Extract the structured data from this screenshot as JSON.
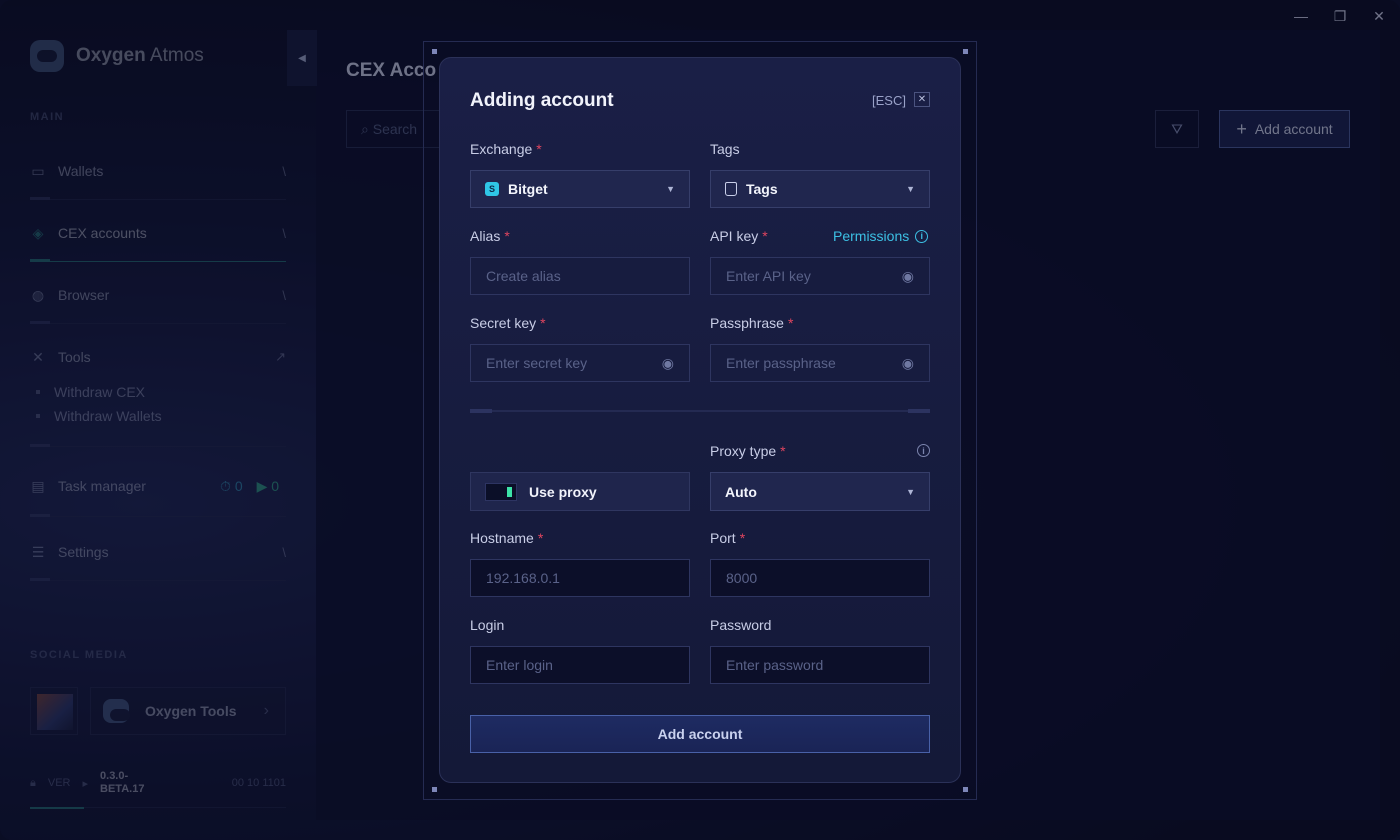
{
  "app": {
    "brand_bold": "Oxygen",
    "brand_light": " Atmos"
  },
  "window_controls": {
    "minimize": "—",
    "restore": "❐",
    "close": "✕"
  },
  "sidebar": {
    "section_main": "MAIN",
    "items": [
      {
        "label": "Wallets",
        "icon": "wallet-icon",
        "arrow": "\\"
      },
      {
        "label": "CEX accounts",
        "icon": "layers-icon",
        "arrow": "\\"
      },
      {
        "label": "Browser",
        "icon": "globe-icon",
        "arrow": "\\"
      },
      {
        "label": "Tools",
        "icon": "tools-icon",
        "arrow": "↗"
      },
      {
        "label": "Task manager",
        "icon": "task-icon"
      },
      {
        "label": "Settings",
        "icon": "sliders-icon",
        "arrow": "\\"
      }
    ],
    "tools_sub": [
      "Withdraw CEX",
      "Withdraw Wallets"
    ],
    "task_counters": {
      "scheduled": "0",
      "running": "0"
    },
    "section_social": "SOCIAL MEDIA",
    "social_name": "Oxygen Tools",
    "version_label": "VER",
    "version_value": "0.3.0-\nBETA.17",
    "version_extra": "00 10 1101"
  },
  "main": {
    "title": "CEX Acco",
    "search_placeholder": "Search",
    "add_account": "Add account"
  },
  "modal": {
    "title": "Adding account",
    "esc": "[ESC]",
    "exchange_label": "Exchange",
    "exchange_value": "Bitget",
    "tags_label": "Tags",
    "tags_value": "Tags",
    "alias_label": "Alias",
    "alias_placeholder": "Create alias",
    "api_key_label": "API key",
    "permissions": "Permissions",
    "api_key_placeholder": "Enter API key",
    "secret_label": "Secret key",
    "secret_placeholder": "Enter secret key",
    "passphrase_label": "Passphrase",
    "passphrase_placeholder": "Enter passphrase",
    "proxy_type_label": "Proxy type",
    "use_proxy": "Use proxy",
    "proxy_type_value": "Auto",
    "hostname_label": "Hostname",
    "hostname_placeholder": "192.168.0.1",
    "port_label": "Port",
    "port_placeholder": "8000",
    "login_label": "Login",
    "login_placeholder": "Enter login",
    "password_label": "Password",
    "password_placeholder": "Enter password",
    "submit": "Add account",
    "required_mark": "*"
  },
  "colors": {
    "accent": "#3cc0e4",
    "required": "#e0455f",
    "active_line": "#2fa39a",
    "toggle_on": "#3de3a8"
  }
}
